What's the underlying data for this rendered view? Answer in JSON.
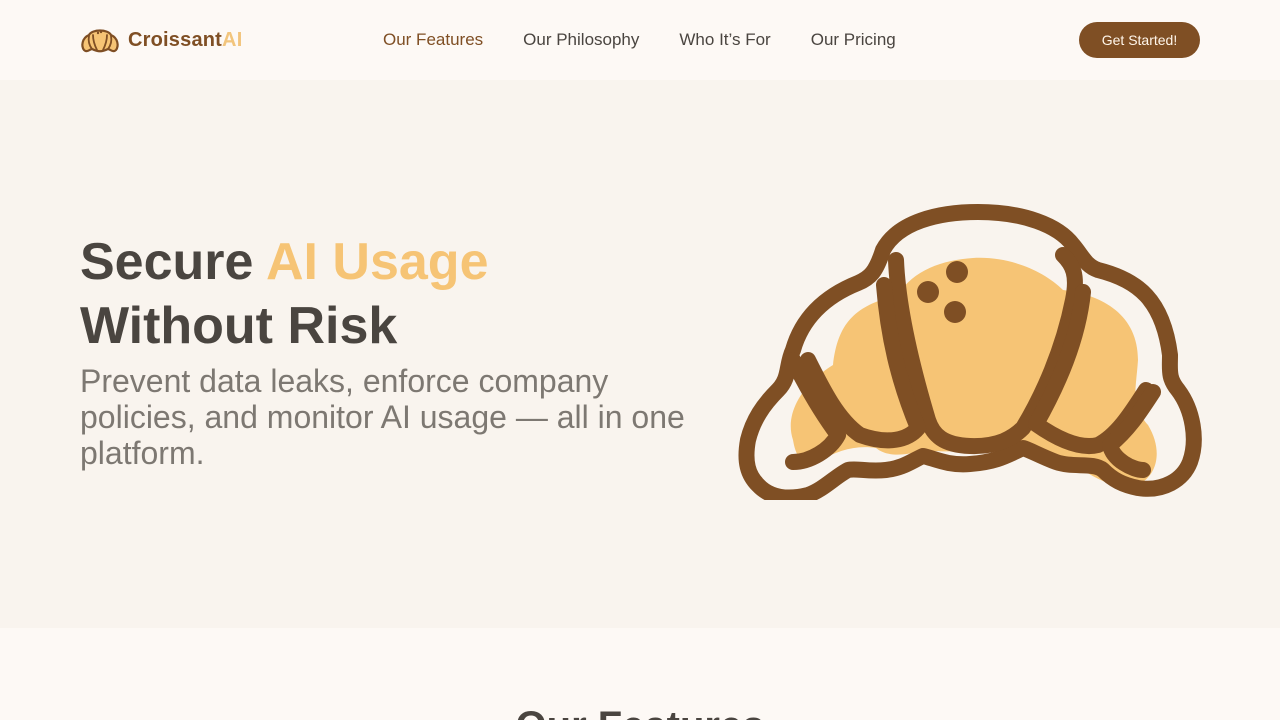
{
  "header": {
    "logo_main": "Croissant",
    "logo_accent": "AI",
    "nav": [
      {
        "label": "Our Features"
      },
      {
        "label": "Our Philosophy"
      },
      {
        "label": "Who It’s For"
      },
      {
        "label": "Our Pricing"
      }
    ],
    "active_nav": "Our Features",
    "cta_label": "Get Started!"
  },
  "hero": {
    "title_start": "Secure ",
    "title_accent": "AI Usage",
    "title_end": "Without Risk",
    "subtitle": "Prevent data leaks, enforce company policies, and monitor AI usage — all in one platform."
  },
  "features": {
    "title": "Our Features"
  },
  "colors": {
    "brand": "#7f4f24",
    "accent": "#f6c475",
    "hero_bg": "#f9f4ee",
    "page_bg": "#fdf9f5"
  },
  "icons": {
    "logo": "croissant-icon",
    "hero_image": "croissant-illustration"
  }
}
